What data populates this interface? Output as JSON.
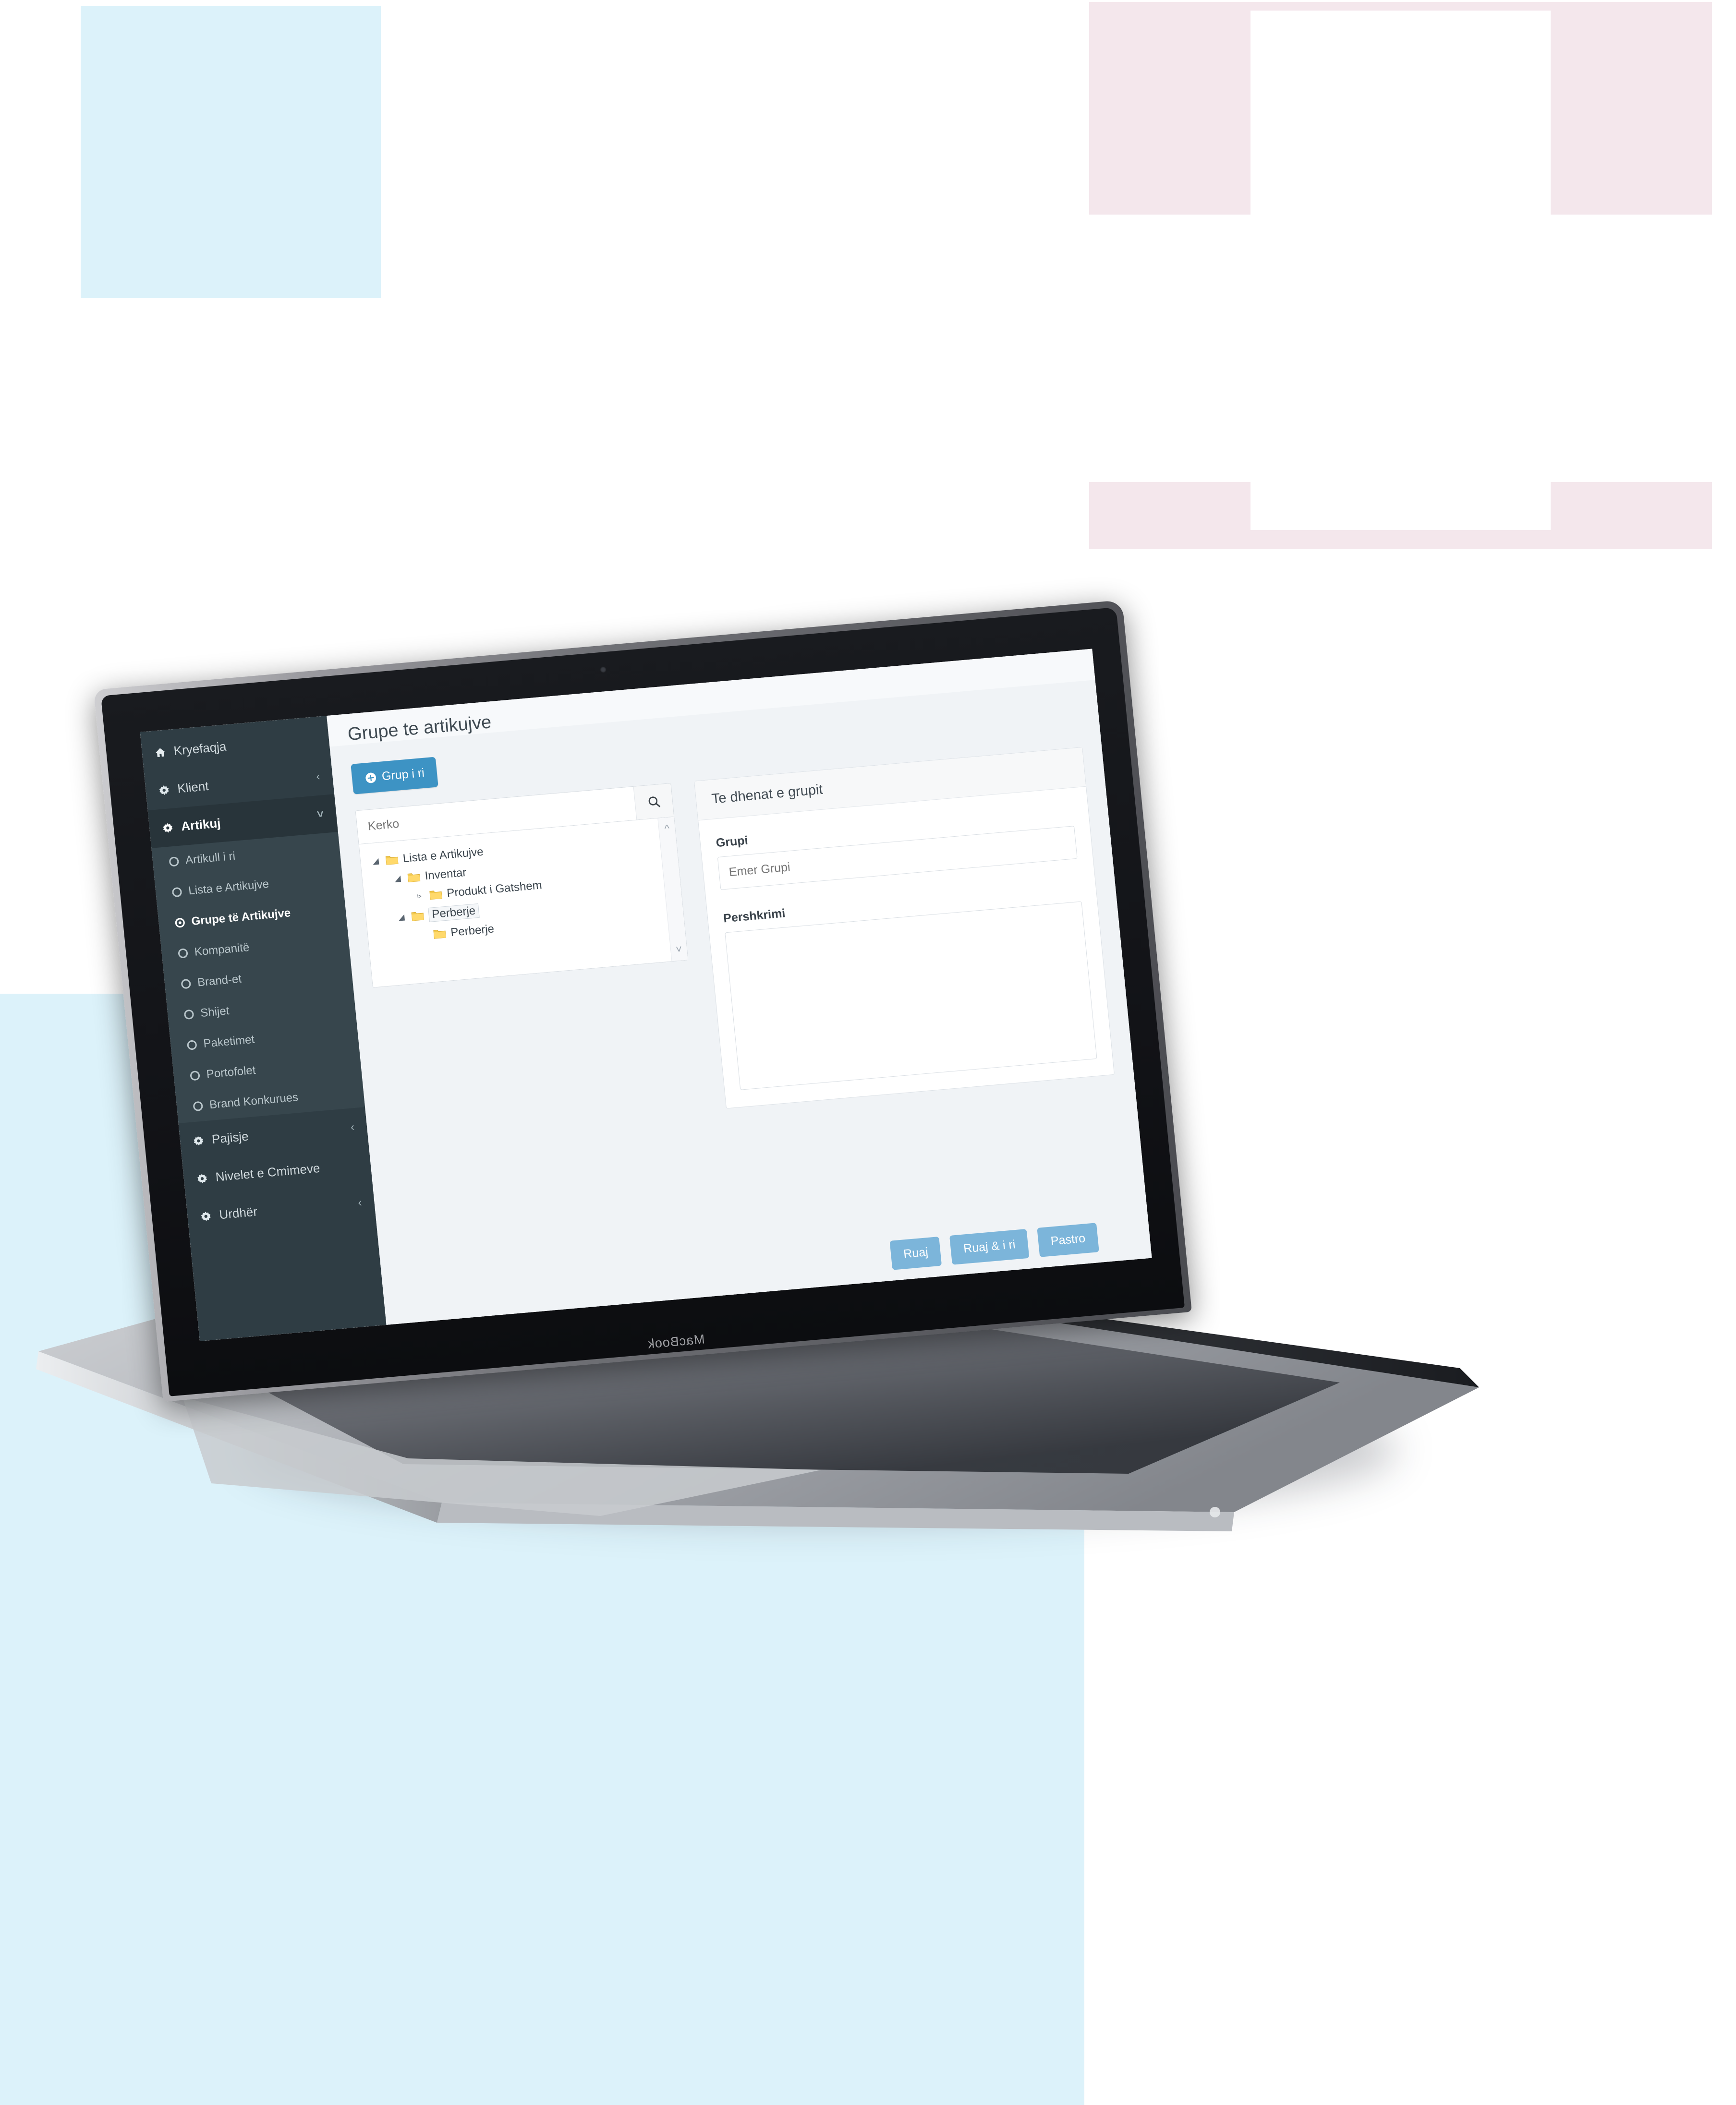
{
  "device": {
    "brand_label": "MacBook"
  },
  "app": {
    "page_title": "Grupe te artikujve",
    "new_group_button": "Grup i ri",
    "new_group_icon": "plus-circle-icon"
  },
  "sidebar": {
    "items": [
      {
        "label": "Kryefaqja",
        "icon": "home-icon",
        "chevron": "",
        "active": false
      },
      {
        "label": "Klient",
        "icon": "gear-icon",
        "chevron": "‹",
        "active": false
      },
      {
        "label": "Artikuj",
        "icon": "gear-icon",
        "chevron": "˅",
        "active": true
      }
    ],
    "submenu": [
      {
        "label": "Artikull i ri",
        "active": false
      },
      {
        "label": "Lista e Artikujve",
        "active": false
      },
      {
        "label": "Grupe të Artikujve",
        "active": true
      },
      {
        "label": "Kompanitë",
        "active": false
      },
      {
        "label": "Brand-et",
        "active": false
      },
      {
        "label": "Shijet",
        "active": false
      },
      {
        "label": "Paketimet",
        "active": false
      },
      {
        "label": "Portofolet",
        "active": false
      },
      {
        "label": "Brand Konkurues",
        "active": false
      }
    ],
    "items_bottom": [
      {
        "label": "Pajisje",
        "icon": "gear-icon",
        "chevron": "‹"
      },
      {
        "label": "Nivelet e Cmimeve",
        "icon": "gear-icon",
        "chevron": ""
      },
      {
        "label": "Urdhër",
        "icon": "gear-icon",
        "chevron": "‹"
      }
    ]
  },
  "tree_pane": {
    "search_placeholder": "Kerko",
    "search_value": "",
    "search_icon": "search-icon",
    "scroll_up_icon": "chevron-up-icon",
    "scroll_down_icon": "chevron-down-icon",
    "nodes": [
      {
        "label": "Lista e Artikujve",
        "depth": 0,
        "toggle": "◢",
        "selected": false
      },
      {
        "label": "Inventar",
        "depth": 1,
        "toggle": "◢",
        "selected": false
      },
      {
        "label": "Produkt i Gatshem",
        "depth": 2,
        "toggle": "▹",
        "selected": false
      },
      {
        "label": "Perberje",
        "depth": 1,
        "toggle": "◢",
        "selected": true
      },
      {
        "label": "Perberje",
        "depth": 2,
        "toggle": "",
        "selected": false
      }
    ]
  },
  "form_pane": {
    "card_title": "Te dhenat e grupit",
    "group_label": "Grupi",
    "group_placeholder": "Emer Grupi",
    "group_value": "",
    "description_label": "Pershkrimi",
    "description_value": ""
  },
  "actions": [
    {
      "label": "Ruaj"
    },
    {
      "label": "Ruaj & i ri"
    },
    {
      "label": "Pastro"
    }
  ],
  "colors": {
    "accent_blue": "#3d93c4",
    "action_blue": "#7cb5da",
    "sidebar_bg": "#2f3d44",
    "submenu_bg": "#37464d",
    "deco_blue": "#dcf2fa",
    "deco_pink": "#f4e7ec"
  }
}
